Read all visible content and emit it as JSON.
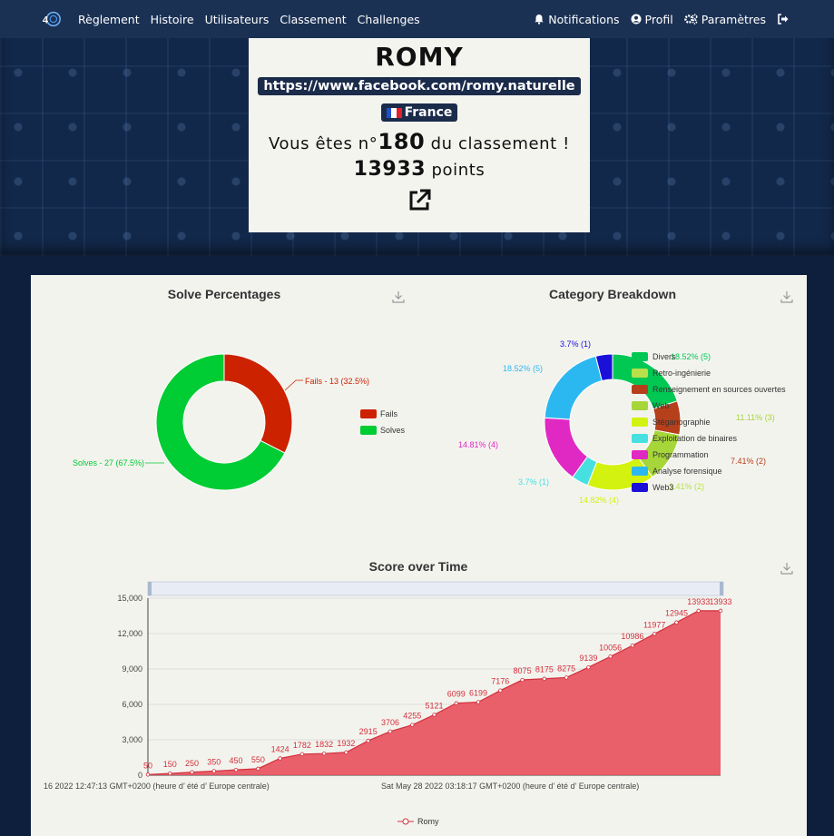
{
  "nav": {
    "items": [
      "Règlement",
      "Histoire",
      "Utilisateurs",
      "Classement",
      "Challenges"
    ],
    "notifications": "Notifications",
    "profile": "Profil",
    "settings": "Paramètres"
  },
  "profile": {
    "name": "ROMY",
    "link": "https://www.facebook.com/romy.naturelle",
    "country": "France",
    "rank_prefix": "Vous êtes n°",
    "rank": "180",
    "rank_suffix": " du classement !",
    "points": "13933",
    "points_suffix": " points"
  },
  "colors": {
    "fails": "#cc2200",
    "solves": "#00cc33",
    "score": "#e8505b"
  },
  "chart_data": [
    {
      "type": "pie",
      "title": "Solve Percentages",
      "labels": [
        "Fails",
        "Solves"
      ],
      "values": [
        13,
        27
      ],
      "slice_labels": [
        "Fails - 13 (32.5%)",
        "Solves - 27 (67.5%)"
      ],
      "legend": "right"
    },
    {
      "type": "pie",
      "title": "Category Breakdown",
      "labels": [
        "Divers",
        "Retro-ingénierie",
        "Renseignement en sources ouvertes",
        "Web",
        "Stéganographie",
        "Exploitation de binaires",
        "Programmation",
        "Analyse forensique",
        "Web3"
      ],
      "values": [
        5,
        0,
        2,
        3,
        4,
        1,
        4,
        5,
        1
      ],
      "colors": [
        "#00c853",
        "#b8e04a",
        "#b5401b",
        "#a6d63a",
        "#d4f20f",
        "#46e0e0",
        "#e029c2",
        "#2bb8f0",
        "#1a10d8"
      ],
      "slice_labels": [
        "18.52% (5)",
        "7.41% (2)",
        "11.11% (3)",
        "14.82% (4)",
        "3.7% (1)",
        "14.81% (4)",
        "18.52% (5)",
        "3.7% (1)"
      ],
      "partial_label": "3.41% (2)",
      "legend": "right"
    },
    {
      "type": "area",
      "title": "Score over Time",
      "series": [
        {
          "name": "Romy",
          "values": [
            50,
            150,
            250,
            350,
            450,
            550,
            1424,
            1782,
            1832,
            1932,
            2915,
            3706,
            4255,
            5121,
            6099,
            6199,
            7176,
            8075,
            8175,
            8275,
            9139,
            10056,
            10986,
            11977,
            12945,
            13933,
            13933
          ]
        }
      ],
      "x_labels": [
        "16 2022 12:47:13 GMT+0200 (heure d’   été d’   Europe centrale)",
        "Sat May 28 2022 03:18:17 GMT+0200 (heure d’   été d’   Europe centrale)"
      ],
      "yticks": [
        "0",
        "3,000",
        "6,000",
        "9,000",
        "12,000",
        "15,000"
      ],
      "ylim": [
        0,
        15000
      ],
      "grid": true,
      "legend": "bottom"
    }
  ]
}
